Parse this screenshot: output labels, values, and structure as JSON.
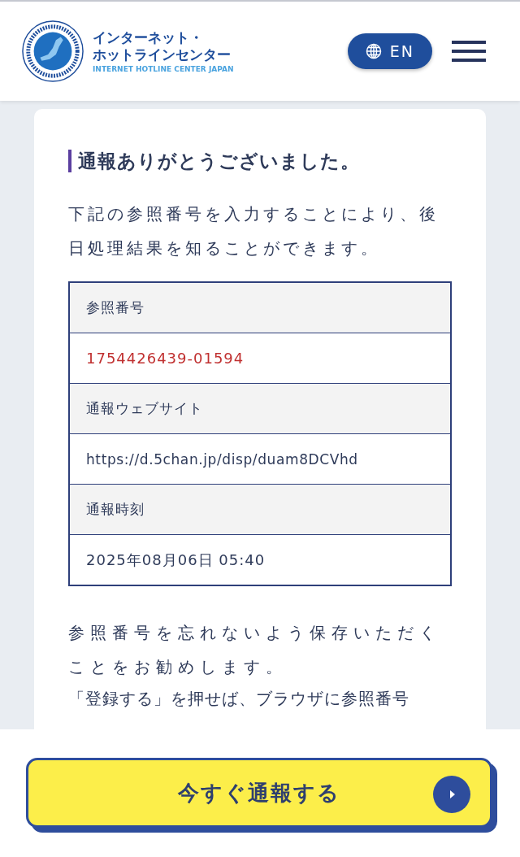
{
  "header": {
    "title_line1": "インターネット・",
    "title_line2": "ホットラインセンター",
    "subtitle": "INTERNET HOTLINE CENTER JAPAN",
    "language_button": "EN"
  },
  "card": {
    "heading": "通報ありがとうございました。",
    "intro": "下記の参照番号を入力することにより、後日処理結果を知ることができます。",
    "table": [
      {
        "label": "参照番号",
        "value": "1754426439-01594",
        "kind": "reference"
      },
      {
        "label": "通報ウェブサイト",
        "value": "https://d.5chan.jp/disp/duam8DCVhd",
        "kind": "plain"
      },
      {
        "label": "通報時刻",
        "value": "2025年08月06日 05:40",
        "kind": "plain"
      }
    ],
    "note": "参照番号を忘れないよう保存いただくことをお勧めします。",
    "note_cut": "「登録する」を押せば、ブラウザに参照番号"
  },
  "report_button": "今すぐ通報する"
}
